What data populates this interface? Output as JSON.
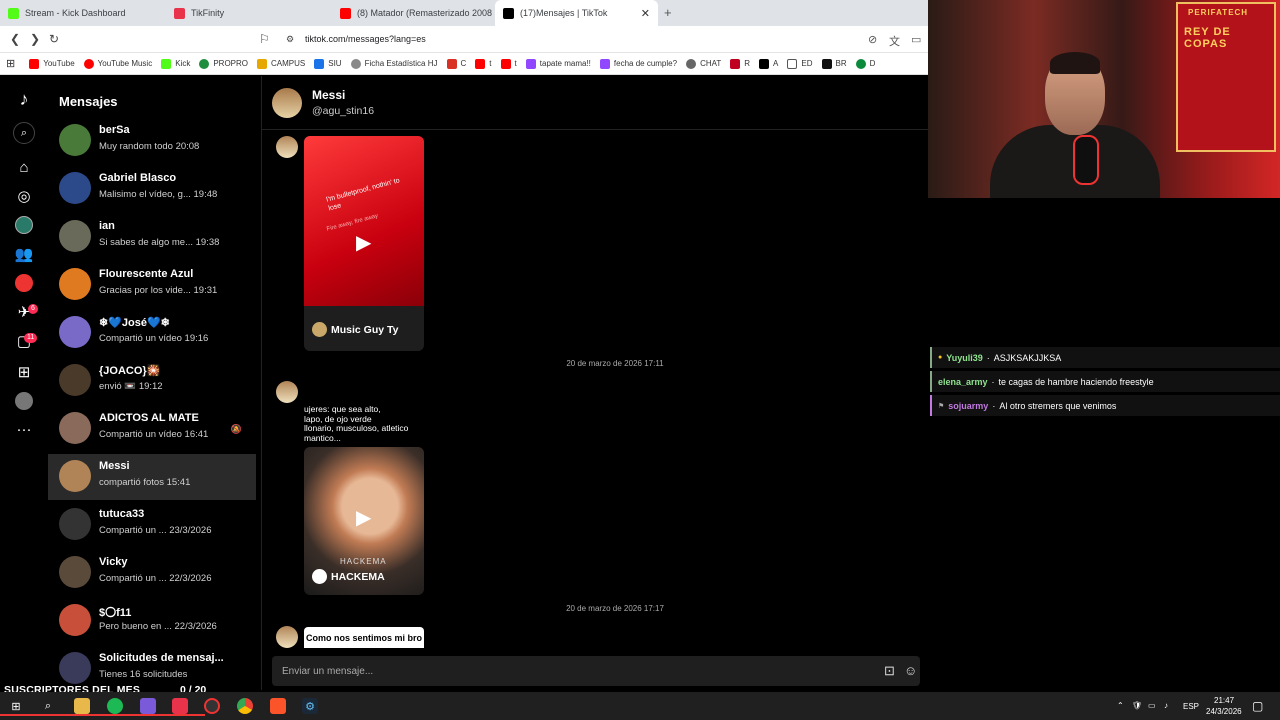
{
  "browser": {
    "tabs": [
      {
        "label": "Stream - Kick Dashboard",
        "color": "#53fc18"
      },
      {
        "label": "TikFinity",
        "color": "#e8334a"
      },
      {
        "label": "(8) Matador (Remasterizado 2008) - Y...",
        "color": "#ff0000"
      },
      {
        "label": "(17)Mensajes | TikTok",
        "color": "#000000",
        "active": true
      }
    ],
    "url": "tiktok.com/messages?lang=es",
    "bookmarks": [
      {
        "label": "YouTube",
        "color": "#ff0000"
      },
      {
        "label": "YouTube Music",
        "color": "#ff0000"
      },
      {
        "label": "Kick",
        "color": "#53fc18"
      },
      {
        "label": "PROPRO",
        "color": "#1e8e3e"
      },
      {
        "label": "CAMPUS",
        "color": "#e6a700"
      },
      {
        "label": "SIU",
        "color": "#1a73e8"
      },
      {
        "label": "Ficha Estadística HJ",
        "color": "#888888"
      },
      {
        "label": "C",
        "color": "#d93025"
      },
      {
        "label": "t",
        "color": "#ff0000"
      },
      {
        "label": "t",
        "color": "#ff0000"
      },
      {
        "label": "tapate mama!!",
        "color": "#9146ff"
      },
      {
        "label": "fecha de cumple?",
        "color": "#9146ff"
      },
      {
        "label": "CHAT",
        "color": "#666666"
      },
      {
        "label": "R",
        "color": "#c00020"
      },
      {
        "label": "A",
        "color": "#000000"
      },
      {
        "label": "ED",
        "color": "#555555"
      },
      {
        "label": "BR",
        "color": "#111111"
      },
      {
        "label": "D",
        "color": "#0a8a3a"
      }
    ]
  },
  "tiktok": {
    "title": "Mensajes",
    "conversations": [
      {
        "name": "berSa",
        "preview": "Muy random todo 20:08",
        "avatar_color": "#4a7a3a"
      },
      {
        "name": "Gabriel Blasco",
        "preview": "Malisimo el vídeo, g... 19:48",
        "avatar_color": "#2c4a8a"
      },
      {
        "name": "ian",
        "preview": "Si sabes de algo me... 19:38",
        "avatar_color": "#6a6a5a"
      },
      {
        "name": "Flourescente Azul",
        "preview": "Gracias por los vide... 19:31",
        "avatar_color": "#e07a20"
      },
      {
        "name": "❄💙José💙❄",
        "preview": "Compartió un vídeo 19:16",
        "avatar_color": "#7a6ac8"
      },
      {
        "name": "{JOACO}🎇",
        "preview": "envió 📼 19:12",
        "avatar_color": "#4a3a2a"
      },
      {
        "name": "ADICTOS AL MATE",
        "preview": "Compartió un vídeo 16:41",
        "avatar_color": "#8a6a5a",
        "muted": true
      },
      {
        "name": "Messi",
        "preview": "compartió fotos 15:41",
        "avatar_color": "#b08456",
        "selected": true
      },
      {
        "name": "tutuca33",
        "preview": "Compartió un ... 23/3/2026",
        "avatar_color": "#333333"
      },
      {
        "name": "Vicky",
        "preview": "Compartió un ... 22/3/2026",
        "avatar_color": "#5a4a3a"
      },
      {
        "name": "$〇f11",
        "preview": "Pero bueno en ... 22/3/2026",
        "avatar_color": "#c8503a"
      },
      {
        "name": "Solicitudes de mensaj...",
        "preview": "Tienes 16 solicitudes",
        "avatar_color": "#3a3a5a"
      }
    ],
    "chat": {
      "name": "Messi",
      "handle": "@agu_stin16",
      "card1": {
        "lyric": "I'm bulletproof, nothin' to lose",
        "lyric2": "Fire away, fire away",
        "author": "Music Guy Ty"
      },
      "date1": "20 de marzo de 2026 17:11",
      "card2": {
        "text": "ujeres: que sea alto,\nlapo, de ojo verde\nllonario, musculoso, atletico\nmantico...",
        "watermark": "HACKEMA",
        "author": "HACKEMA"
      },
      "date2": "20 de marzo de 2026 17:17",
      "card3": "Como nos sentimos mi bro y",
      "composer_placeholder": "Enviar un mensaje..."
    },
    "badges": {
      "inbox": "6",
      "messages": "11"
    }
  },
  "overlay": {
    "subs_title": "SUSCRIPTORES DEL MES",
    "subs_count": "0  / 20",
    "poster_line1": "REY DE COPAS",
    "poster_line2": "PERIFATECH",
    "chat": [
      {
        "user": "Yuyuli39",
        "message": "ASJKSAKJJKSA",
        "color": "#8fe38f"
      },
      {
        "user": "elena_army",
        "message": "te cagas de hambre haciendo freestyle",
        "color": "#8fe38f"
      },
      {
        "user": "sojuarmy",
        "message": "Al otro stremers que venimos",
        "color": "#c07ae0"
      }
    ]
  },
  "taskbar": {
    "lang": "ESP",
    "time": "21:47",
    "date": "24/3/2026"
  }
}
